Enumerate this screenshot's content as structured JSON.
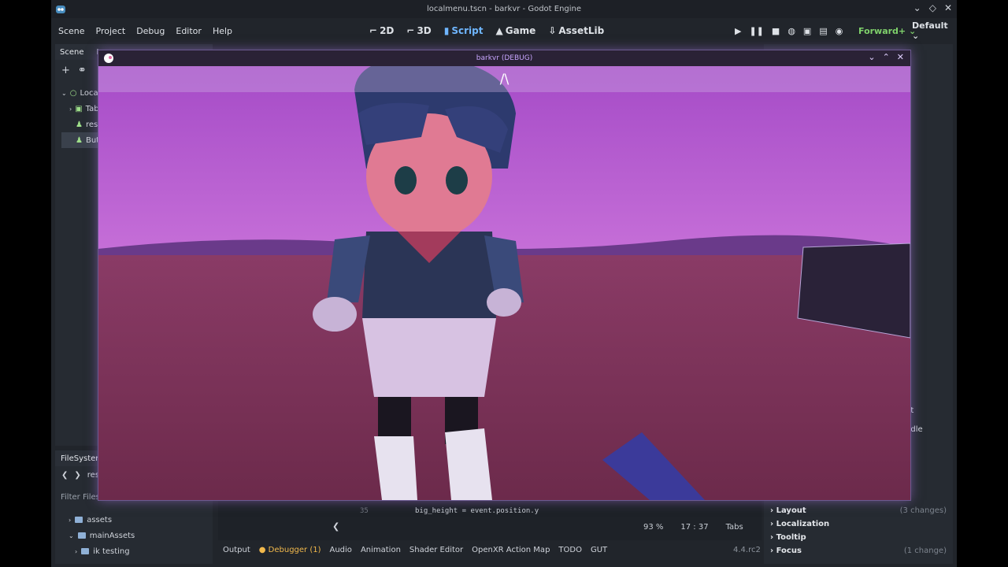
{
  "app": {
    "title": "localmenu.tscn - barkvr - Godot Engine",
    "window_controls": [
      "⌄",
      "◇",
      "✕"
    ]
  },
  "menu": {
    "items": [
      "Scene",
      "Project",
      "Debug",
      "Editor",
      "Help"
    ]
  },
  "workspaces": [
    {
      "label": "2D",
      "icon": "2d-icon"
    },
    {
      "label": "3D",
      "icon": "3d-icon"
    },
    {
      "label": "Script",
      "icon": "script-icon",
      "active": true
    },
    {
      "label": "Game",
      "icon": "game-icon"
    },
    {
      "label": "AssetLib",
      "icon": "assetlib-icon"
    }
  ],
  "run_bar": {
    "renderer": "Forward+",
    "layout": "Default"
  },
  "scene_dock": {
    "tabs": [
      "Scene",
      "Im"
    ],
    "tree": [
      {
        "label": "Local",
        "indent": 0,
        "icon": "node-icon"
      },
      {
        "label": "Tab",
        "indent": 1,
        "icon": "tabcontainer-icon"
      },
      {
        "label": "res",
        "indent": 1,
        "icon": "instance-icon"
      },
      {
        "label": "But",
        "indent": 1,
        "icon": "instance-icon",
        "selected": true
      }
    ]
  },
  "filesystem": {
    "title": "FileSystem",
    "path": "res:",
    "filter_placeholder": "Filter Files",
    "items": [
      {
        "label": "assets",
        "expanded": false,
        "indent": 0
      },
      {
        "label": "mainAssets",
        "expanded": true,
        "indent": 0
      },
      {
        "label": "ik testing",
        "expanded": false,
        "indent": 1
      }
    ]
  },
  "inspector": {
    "rows": [
      {
        "label": "Layout",
        "note": "(3 changes)"
      },
      {
        "label": "Localization",
        "note": ""
      },
      {
        "label": "Tooltip",
        "note": ""
      },
      {
        "label": "Focus",
        "note": "(1 change)"
      }
    ],
    "partial_labels": [
      "nt",
      "ddle"
    ]
  },
  "code": {
    "line_number": "35",
    "line": "big_height = event.position.y",
    "zoom": "93 %",
    "line_col": "17 :   37",
    "indent": "Tabs"
  },
  "bottom_panel": {
    "tabs": [
      "Output",
      "Debugger (1)",
      "Audio",
      "Animation",
      "Shader Editor",
      "OpenXR Action Map",
      "TODO",
      "GUT"
    ],
    "version": "4.4.rc2"
  },
  "game_window": {
    "title": "barkvr (DEBUG)",
    "caret": "/\\",
    "window_controls": [
      "⌄",
      "⌃",
      "✕"
    ]
  },
  "colors": {
    "editor_bg": "#21252b",
    "accent": "#6fb6ff",
    "sky": "#b25bd1",
    "ground": "#7a3357"
  }
}
